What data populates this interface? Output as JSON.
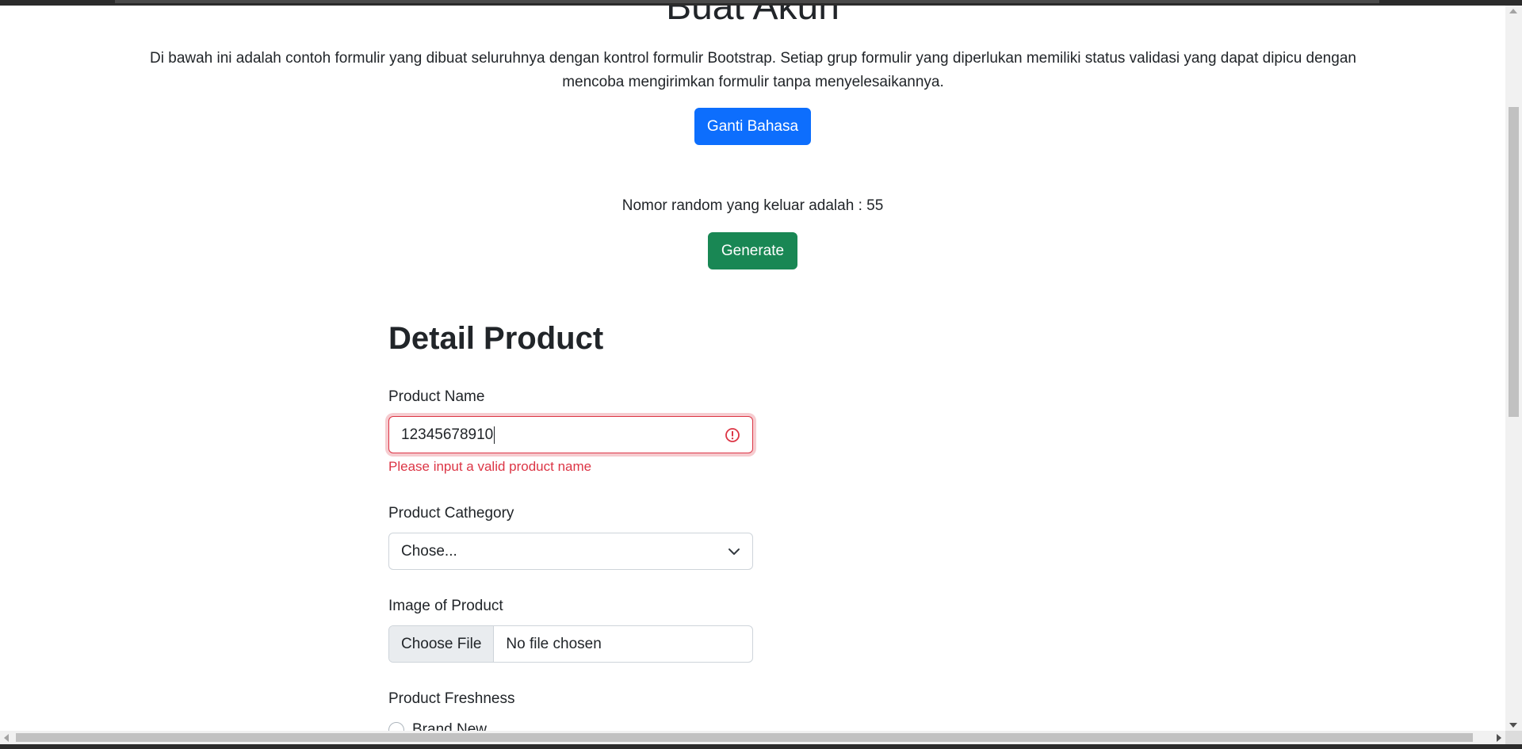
{
  "header": {
    "title": "Buat Akun",
    "description": "Di bawah ini adalah contoh formulir yang dibuat seluruhnya dengan kontrol formulir Bootstrap. Setiap grup formulir yang diperlukan memiliki status validasi yang dapat dipicu dengan mencoba mengirimkan formulir tanpa menyelesaikannya.",
    "language_button": "Ganti Bahasa"
  },
  "random": {
    "text": "Nomor random yang keluar adalah : 55",
    "generate_button": "Generate"
  },
  "form": {
    "title": "Detail Product",
    "product_name": {
      "label": "Product Name",
      "value": "12345678910",
      "error": "Please input a valid product name"
    },
    "product_category": {
      "label": "Product Cathegory",
      "selected": "Chose..."
    },
    "product_image": {
      "label": "Image of Product",
      "button": "Choose File",
      "status": "No file chosen"
    },
    "product_freshness": {
      "label": "Product Freshness",
      "options": [
        "Brand New"
      ]
    }
  },
  "colors": {
    "primary": "#0d6efd",
    "success": "#198754",
    "danger": "#dc3545"
  }
}
